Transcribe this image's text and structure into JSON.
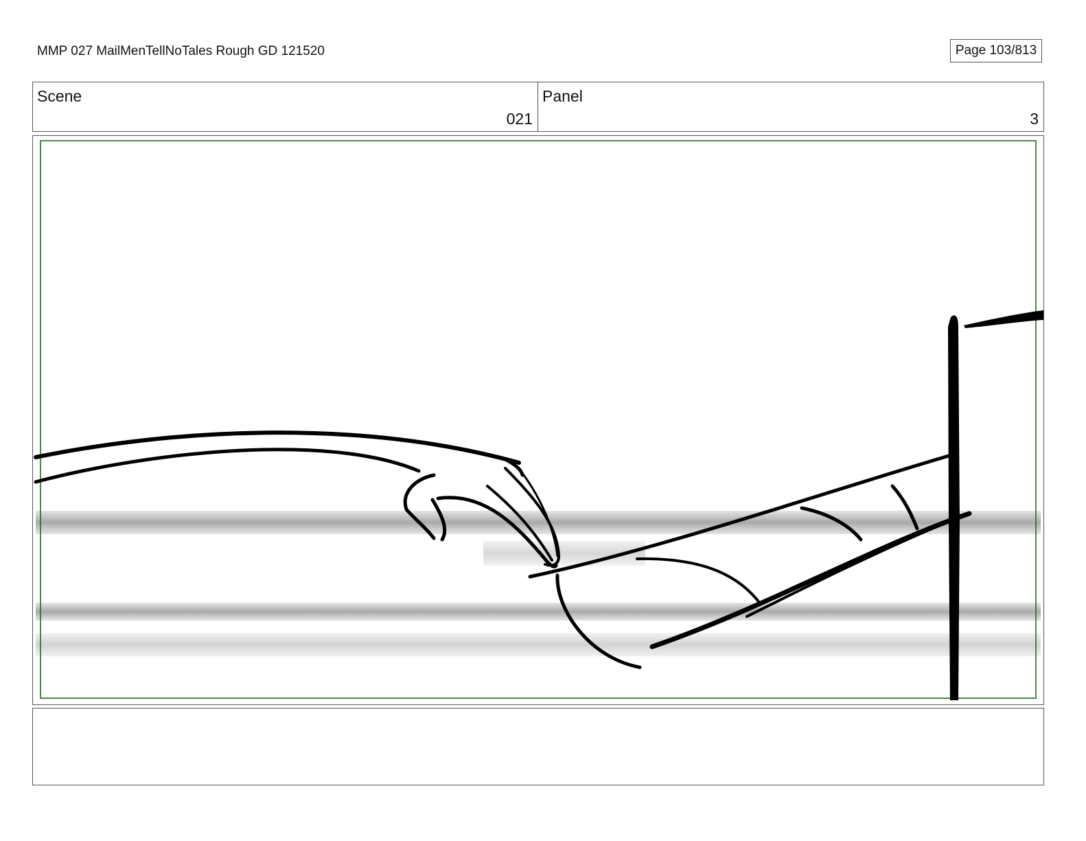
{
  "header": {
    "title": "MMP 027 MailMenTellNoTales Rough GD 121520",
    "page": "Page 103/813"
  },
  "scene": {
    "label": "Scene",
    "value": "021"
  },
  "panel": {
    "label": "Panel",
    "value": "3"
  },
  "frame": {
    "safe_area_color": "#1e6b1e",
    "ink_color": "#000000"
  },
  "notes": {
    "text": ""
  }
}
